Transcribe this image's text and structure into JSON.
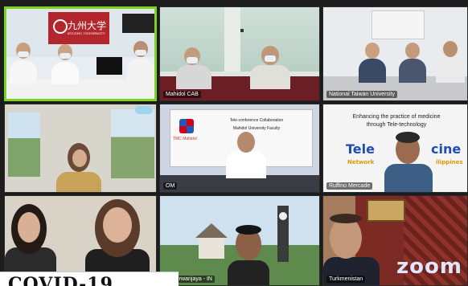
{
  "meeting": {
    "app_logo_text": "zoom",
    "caption_text": "COVID-19"
  },
  "tiles": [
    {
      "sign_text": "九州大学",
      "sign_sub": "KYUSHU UNIVERSITY",
      "name": ""
    },
    {
      "name": "Mahidol CAB"
    },
    {
      "name": "National Taiwan University"
    },
    {
      "name": ""
    },
    {
      "name": "OM",
      "logo_text": "TMC Mahidol",
      "slide_line1": "Tele-conference Collaboration",
      "slide_line2": "Mahidol University Faculty"
    },
    {
      "name": "Ruffino Mercade",
      "slide_line1": "Enhancing the practice of medicine",
      "slide_line2": "through Tele-technology",
      "tele_text": "Tele",
      "medicine_text": "cine",
      "network_text": "Network",
      "country_text": "ilippines"
    },
    {
      "name": ""
    },
    {
      "name": "Nuri Irwanjaya - IN"
    },
    {
      "name": "Turkmenistan"
    }
  ],
  "colors": {
    "active_border": "#7ed321",
    "sign_red": "#b3262e"
  }
}
